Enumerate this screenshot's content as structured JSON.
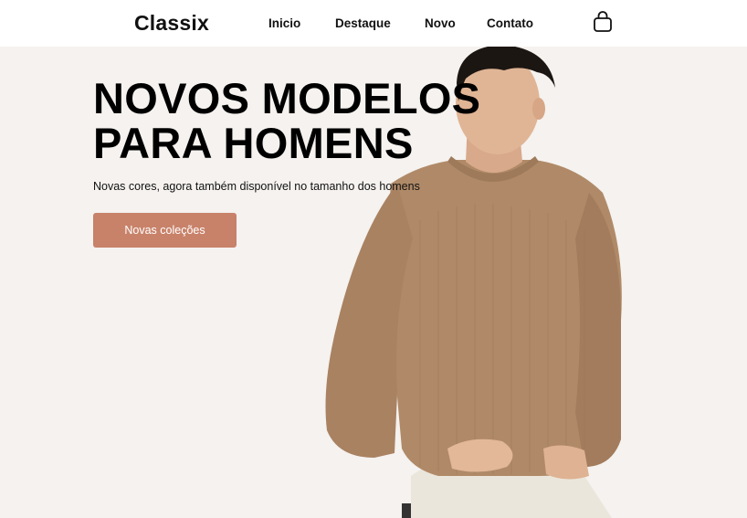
{
  "header": {
    "logo": "Classix",
    "nav": [
      "Inicio",
      "Destaque",
      "Novo",
      "Contato"
    ],
    "cart_icon": "shopping-bag-icon"
  },
  "hero": {
    "title_line1": "NOVOS MODELOS",
    "title_line2": "PARA HOMENS",
    "subtitle": "Novas cores, agora também disponível no tamanho dos homens",
    "cta_label": "Novas coleções",
    "image_alt": "man-in-brown-knit-sweater"
  },
  "colors": {
    "background": "#f5f2ef",
    "header_bg": "#ffffff",
    "accent": "#c8826a",
    "sweater": "#b08a68",
    "text": "#111111"
  }
}
